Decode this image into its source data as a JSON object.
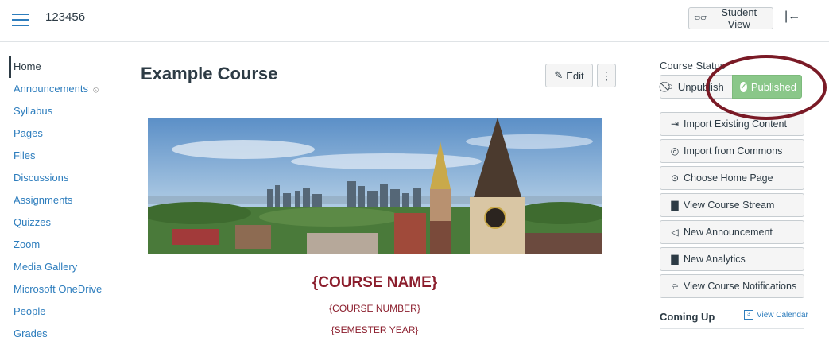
{
  "header": {
    "course_code": "123456",
    "student_view_label": "Student View"
  },
  "nav": {
    "items": [
      {
        "label": "Home",
        "active": true
      },
      {
        "label": "Announcements"
      },
      {
        "label": "Syllabus"
      },
      {
        "label": "Pages"
      },
      {
        "label": "Files"
      },
      {
        "label": "Discussions"
      },
      {
        "label": "Assignments"
      },
      {
        "label": "Quizzes"
      },
      {
        "label": "Zoom"
      },
      {
        "label": "Media Gallery"
      },
      {
        "label": "Microsoft OneDrive"
      },
      {
        "label": "People"
      },
      {
        "label": "Grades"
      }
    ]
  },
  "content": {
    "title": "Example Course",
    "edit_label": "Edit",
    "course_name": "{COURSE NAME}",
    "course_number": "{COURSE NUMBER}",
    "semester_year": "{SEMESTER YEAR}"
  },
  "sidebar": {
    "status_heading": "Course Status",
    "unpublish_label": "Unpublish",
    "published_label": "Published",
    "actions": [
      {
        "label": "Import Existing Content",
        "icon": "import-icon"
      },
      {
        "label": "Import from Commons",
        "icon": "commons-icon"
      },
      {
        "label": "Choose Home Page",
        "icon": "target-icon"
      },
      {
        "label": "View Course Stream",
        "icon": "bar-chart-icon"
      },
      {
        "label": "New Announcement",
        "icon": "megaphone-icon"
      },
      {
        "label": "New Analytics",
        "icon": "bar-chart-icon"
      },
      {
        "label": "View Course Notifications",
        "icon": "bell-icon"
      }
    ],
    "coming_up": "Coming Up",
    "view_calendar": "View Calendar"
  },
  "colors": {
    "link": "#2d7dbd",
    "text": "#2d3b45",
    "published": "#8ac789",
    "accent": "#8b1d2c",
    "annotation": "#7a1a26"
  }
}
